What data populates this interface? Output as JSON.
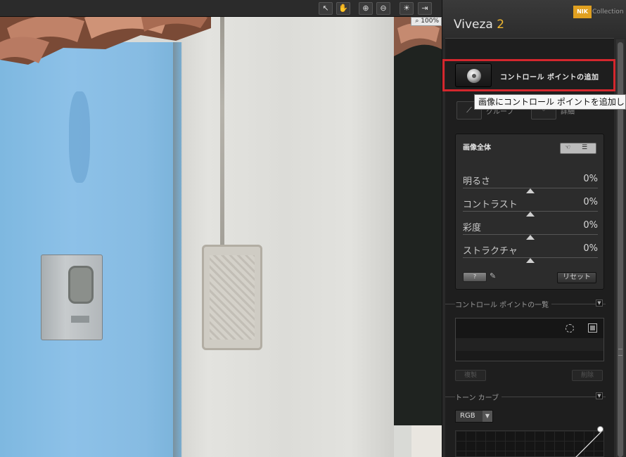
{
  "canvas": {
    "toolbar": {
      "icons": [
        "cursor-arrow-icon",
        "hand-icon",
        "zoom-in-icon",
        "zoom-out-icon",
        "bulb-icon",
        "export-icon"
      ],
      "glyphs": [
        "↖",
        "✋",
        "⊕",
        "⊖",
        "☀",
        "⇥"
      ]
    },
    "zoom": "100%"
  },
  "panel": {
    "logo": "NIK",
    "collection_label": "Collection",
    "app_name": "Viveza",
    "app_version": "2",
    "add_control_point_label": "コントロール ポイントの追加",
    "tooltip": "画像にコントロール ポイントを追加します",
    "tool_labels": [
      "グループ",
      "詳細"
    ],
    "global": {
      "title": "画像全体",
      "sliders": [
        {
          "label": "明るさ",
          "value": "0%"
        },
        {
          "label": "コントラスト",
          "value": "0%"
        },
        {
          "label": "彩度",
          "value": "0%"
        },
        {
          "label": "ストラクチャ",
          "value": "0%"
        }
      ],
      "help_label": "?",
      "reset_label": "リセット"
    },
    "cp_list_header": "コントロール ポイントの一覧",
    "cp_list_buttons": [
      "複製",
      "削除"
    ],
    "tone_curve_header": "トーン カーブ",
    "channel": "RGB"
  },
  "colors": {
    "accent": "#f0b830",
    "highlight": "#d4272d"
  }
}
